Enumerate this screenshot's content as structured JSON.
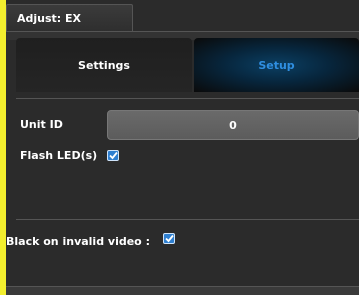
{
  "window": {
    "title": "Adjust: EX"
  },
  "tabs": [
    {
      "label": "Settings",
      "active": false
    },
    {
      "label": "Setup",
      "active": true
    }
  ],
  "setup": {
    "unit_id": {
      "label": "Unit ID",
      "value": "0"
    },
    "flash_leds": {
      "label": "Flash LED(s)",
      "checked": true
    },
    "black_on_invalid_video": {
      "label": "Black on invalid video :",
      "checked": true
    }
  },
  "colors": {
    "background": "#f3ef2e",
    "panel": "#2b2b2b",
    "active_tab_text": "#2f8ee0",
    "checkbox": "#2e7fd0"
  },
  "icons": {
    "checkbox": "checkmark-icon"
  }
}
